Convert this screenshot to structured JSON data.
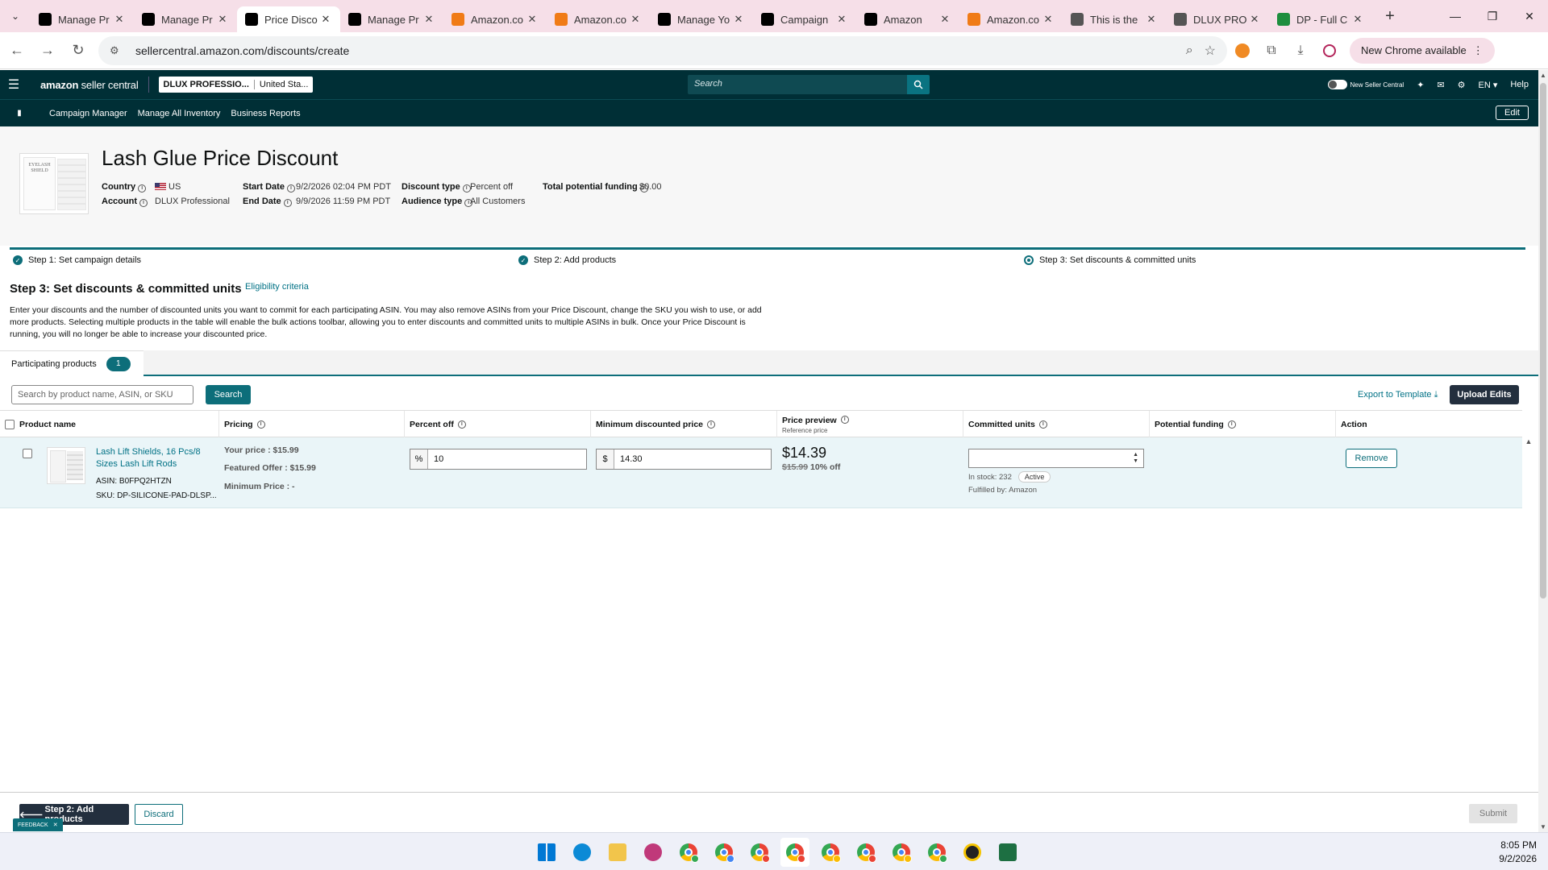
{
  "browser": {
    "tabs": [
      {
        "title": "Manage Pr",
        "favicon": "amazon-icon",
        "color": "#000000"
      },
      {
        "title": "Manage Pr",
        "favicon": "amazon-icon",
        "color": "#000000"
      },
      {
        "title": "Price Disco",
        "favicon": "amazon-icon",
        "color": "#000000",
        "active": true
      },
      {
        "title": "Manage Pr",
        "favicon": "amazon-icon",
        "color": "#000000"
      },
      {
        "title": "Amazon.co",
        "favicon": "amazon-orange-icon",
        "color": "#f07b16"
      },
      {
        "title": "Amazon.co",
        "favicon": "amazon-orange-icon",
        "color": "#f07b16"
      },
      {
        "title": "Manage Yo",
        "favicon": "amazon-icon",
        "color": "#000000"
      },
      {
        "title": "Campaign",
        "favicon": "mail-icon",
        "color": "#000000"
      },
      {
        "title": "Amazon",
        "favicon": "mail-icon",
        "color": "#000000"
      },
      {
        "title": "Amazon.co",
        "favicon": "amazon-orange-icon",
        "color": "#f07b16"
      },
      {
        "title": "This is the",
        "favicon": "globe-icon",
        "color": "#555555"
      },
      {
        "title": "DLUX PRO",
        "favicon": "globe-icon",
        "color": "#555555"
      },
      {
        "title": "DP - Full C",
        "favicon": "sheets-icon",
        "color": "#1e8e3e"
      }
    ],
    "new_tab": "+",
    "url": "sellercentral.amazon.com/discounts/create",
    "new_chrome": "New Chrome available"
  },
  "seller_central": {
    "logo_bold": "amazon",
    "logo_light": "seller central",
    "account_name": "DLUX PROFESSIO...",
    "marketplace": "United Sta...",
    "search_placeholder": "Search",
    "new_seller_central": "New Seller Central",
    "language": "EN",
    "help": "Help",
    "subnav": [
      "Campaign Manager",
      "Manage All Inventory",
      "Business Reports"
    ],
    "edit": "Edit"
  },
  "summary": {
    "title": "Lash Glue Price Discount",
    "thumb_text": "EYELASH SHIELD",
    "country_label": "Country",
    "country_value": "US",
    "account_label": "Account",
    "account_value": "DLUX Professional",
    "start_label": "Start Date",
    "start_value": "9/2/2026 02:04 PM PDT",
    "end_label": "End Date",
    "end_value": "9/9/2026 11:59 PM PDT",
    "discount_type_label": "Discount type",
    "discount_type_value": "Percent off",
    "audience_label": "Audience type",
    "audience_value": "All Customers",
    "funding_label": "Total potential funding",
    "funding_value": "$0.00"
  },
  "steps": [
    {
      "label": "Step 1: Set campaign details",
      "state": "done"
    },
    {
      "label": "Step 2: Add products",
      "state": "done"
    },
    {
      "label": "Step 3: Set discounts & committed units",
      "state": "current"
    }
  ],
  "section": {
    "heading": "Step 3: Set discounts & committed units",
    "eligibility": "Eligibility criteria",
    "description": "Enter your discounts and the number of discounted units you want to commit for each participating ASIN. You may also remove ASINs from your Price Discount, change the SKU you wish to use, or add more products. Selecting multiple products in the table will enable the bulk actions toolbar, allowing you to enter discounts and committed units to multiple ASINs in bulk. Once your Price Discount is running, you will no longer be able to increase your discounted price."
  },
  "participating": {
    "tab_label": "Participating products",
    "count": "1",
    "search_placeholder": "Search by product name, ASIN, or SKU",
    "search_button": "Search",
    "export": "Export to Template",
    "upload": "Upload Edits"
  },
  "table": {
    "headers": {
      "product": "Product name",
      "pricing": "Pricing",
      "percent_off": "Percent off",
      "min_price": "Minimum discounted price",
      "price_preview": "Price preview",
      "price_preview_sub": "Reference price",
      "committed": "Committed units",
      "funding": "Potential funding",
      "action": "Action"
    },
    "row": {
      "name": "Lash Lift Shields, 16 Pcs/8 Sizes Lash Lift Rods",
      "asin": "ASIN: B0FPQ2HTZN",
      "sku": "SKU: DP-SILICONE-PAD-DLSP...",
      "your_price": "Your price : $15.99",
      "featured_offer": "Featured Offer : $15.99",
      "minimum_price": "Minimum Price : -",
      "percent_prefix": "%",
      "percent_value": "10",
      "min_prefix": "$",
      "min_value": "14.30",
      "preview_price": "$14.39",
      "reference_price": "$15.99",
      "preview_off": "10% off",
      "committed_value": "",
      "in_stock": "In stock: 232",
      "status": "Active",
      "fulfilled": "Fulfilled by: Amazon",
      "remove": "Remove"
    }
  },
  "footer": {
    "back": "Step 2: Add products",
    "discard": "Discard",
    "submit": "Submit",
    "feedback": "FEEDBACK"
  },
  "taskbar": {
    "time": "8:05 PM",
    "date": "9/2/2026",
    "apps": [
      {
        "name": "windows-start-icon",
        "color": "#0078d4"
      },
      {
        "name": "edge-icon",
        "color": "#0c8ad6"
      },
      {
        "name": "file-explorer-icon",
        "color": "#f2c54b"
      },
      {
        "name": "snipping-tool-icon",
        "color": "#c0397a"
      },
      {
        "name": "chrome-icon",
        "color": "#34a853"
      },
      {
        "name": "chrome-icon",
        "color": "#4285f4"
      },
      {
        "name": "chrome-icon",
        "color": "#ea4335"
      },
      {
        "name": "chrome-icon",
        "color": "#ea4335"
      },
      {
        "name": "chrome-icon",
        "color": "#fbbc04"
      },
      {
        "name": "chrome-icon",
        "color": "#ea4335"
      },
      {
        "name": "chrome-icon",
        "color": "#fbbc04"
      },
      {
        "name": "chrome-icon",
        "color": "#34a853"
      },
      {
        "name": "messages-icon",
        "color": "#f5c400"
      },
      {
        "name": "excel-icon",
        "color": "#1d6f42"
      }
    ]
  },
  "colors": {
    "header": "#002f36",
    "accent": "#0d6e7a",
    "link": "#007185"
  }
}
